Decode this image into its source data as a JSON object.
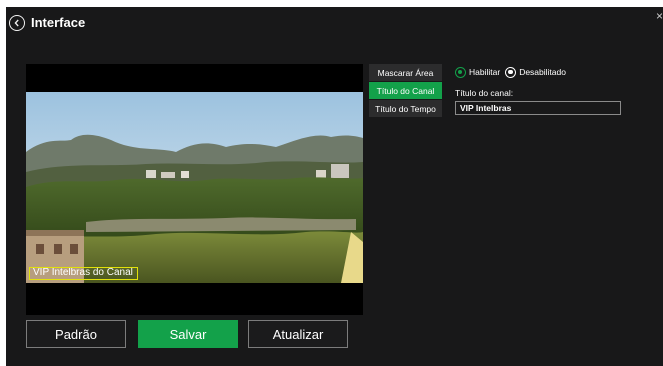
{
  "header": {
    "title": "Interface",
    "back_icon": "chevron-left-circle-icon",
    "close_label": "×"
  },
  "preview": {
    "osd_text": "VIP Intelbras do Canal"
  },
  "menu": {
    "items": [
      "Mascarar Área",
      "Título do Canal",
      "Título do Tempo"
    ],
    "active_index": 1
  },
  "settings": {
    "enable_label": "Habilitar",
    "disable_label": "Desabilitado",
    "selected": "Habilitar",
    "channel_title_label": "Título do canal:",
    "channel_title_value": "VIP Intelbras"
  },
  "buttons": {
    "default_label": "Padrão",
    "save_label": "Salvar",
    "refresh_label": "Atualizar"
  },
  "colors": {
    "background": "#181819",
    "accent_green": "#13a14a",
    "osd_border": "#e2e20a"
  }
}
